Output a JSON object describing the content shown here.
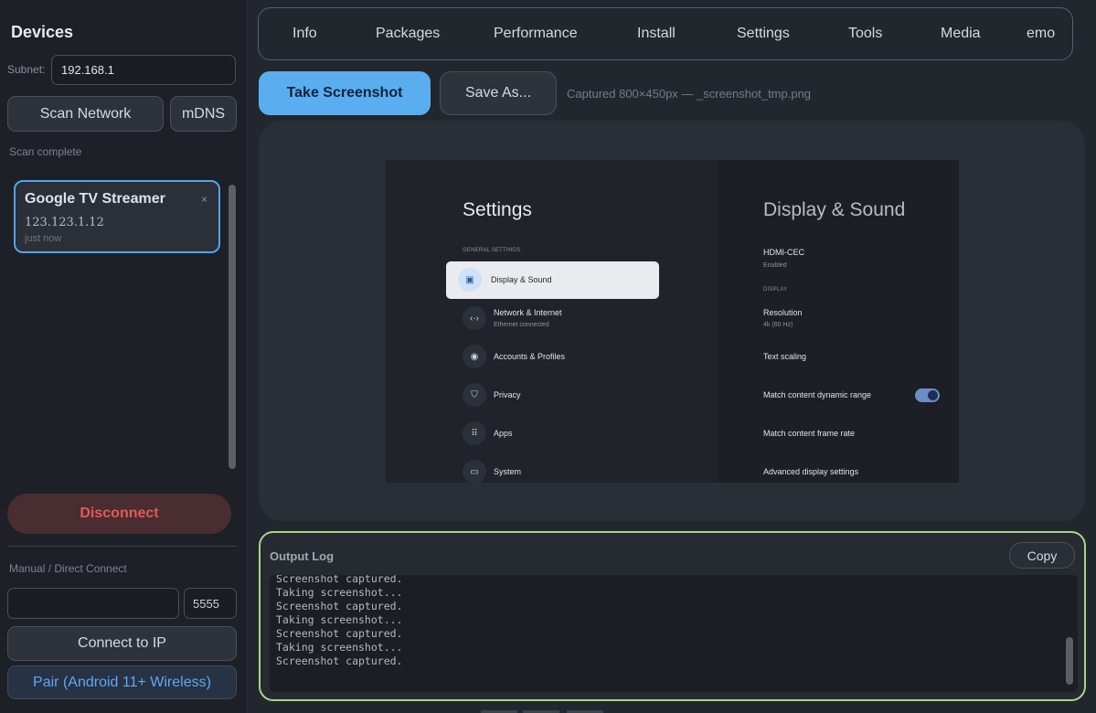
{
  "sidebar": {
    "title": "Devices",
    "subnet_label": "Subnet:",
    "subnet_value": "192.168.1",
    "scan_button": "Scan Network",
    "mdns_button": "mDNS",
    "scan_status": "Scan complete",
    "devices": [
      {
        "name": "Google TV Streamer",
        "ip": "123.123.1.12",
        "time": "just now",
        "close": "×"
      }
    ],
    "disconnect_button": "Disconnect",
    "manual_label": "Manual / Direct Connect",
    "ip_value": "",
    "port_value": "5555",
    "connect_button": "Connect to IP",
    "pair_button": "Pair (Android 11+ Wireless)"
  },
  "tabs": [
    "Info",
    "Packages",
    "Performance",
    "Install",
    "Settings",
    "Tools",
    "Media",
    "emo"
  ],
  "toolbar": {
    "screenshot_button": "Take Screenshot",
    "saveas_button": "Save As...",
    "capture_info": "Captured  800×450px  —  _screenshot_tmp.png"
  },
  "tv": {
    "left_title": "Settings",
    "section": "GENERAL SETTINGS",
    "selected_item": "Display & Sound",
    "items": [
      {
        "label": "Network & Internet",
        "sub": "Ethernet connected",
        "icon": "network-icon",
        "glyph": "‹·›"
      },
      {
        "label": "Accounts & Profiles",
        "sub": "",
        "icon": "account-icon",
        "glyph": "◉"
      },
      {
        "label": "Privacy",
        "sub": "",
        "icon": "shield-icon",
        "glyph": "⛉"
      },
      {
        "label": "Apps",
        "sub": "",
        "icon": "apps-grid-icon",
        "glyph": "⠿"
      },
      {
        "label": "System",
        "sub": "",
        "icon": "monitor-icon",
        "glyph": "▭"
      }
    ],
    "right_title": "Display & Sound",
    "hdmi_label": "HDMI-CEC",
    "hdmi_value": "Enabled",
    "display_section": "DISPLAY",
    "resolution_label": "Resolution",
    "resolution_value": "4k (60 Hz)",
    "text_scaling": "Text scaling",
    "dynamic_range": "Match content dynamic range",
    "dynamic_range_on": true,
    "frame_rate": "Match content frame rate",
    "advanced": "Advanced display settings"
  },
  "log": {
    "title": "Output Log",
    "copy_button": "Copy",
    "lines": "Screenshot captured.\nTaking screenshot...\nScreenshot captured.\nTaking screenshot...\nScreenshot captured.\nTaking screenshot...\nScreenshot captured."
  },
  "colors": {
    "accent": "#5aaeef",
    "danger": "#e05a5a",
    "log_border": "#a6d48c",
    "selected_device_border": "#4ea6ec"
  }
}
